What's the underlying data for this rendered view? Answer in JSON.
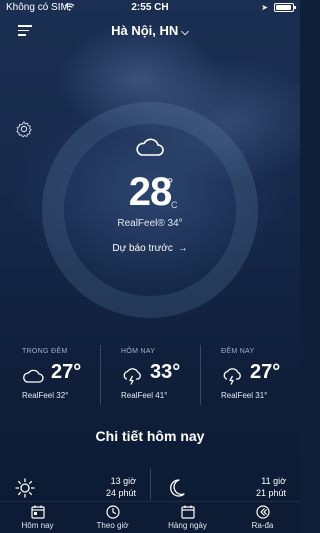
{
  "status_bar": {
    "carrier": "Không có SIM",
    "time": "2:55 CH",
    "battery_level": 0.95,
    "icons": [
      "wifi-icon",
      "location-arrow-icon",
      "battery-icon"
    ]
  },
  "header": {
    "city": "Hà Nội, HN",
    "menu_icon": "menu-icon",
    "dropdown_icon": "chevron-down-icon"
  },
  "settings_icon": "gear-icon",
  "current": {
    "icon": "cloud-icon",
    "temperature": "28",
    "degree": "°",
    "unit": "C",
    "realfeel": "RealFeel® 34°",
    "forecast_link": "Dự báo trước",
    "forecast_arrow": "→"
  },
  "periods": [
    {
      "label": "TRONG ĐÊM",
      "icon": "cloud-icon",
      "temp": "27°",
      "realfeel": "RealFeel 32°"
    },
    {
      "label": "HÔM NAY",
      "icon": "thunderstorm-icon",
      "temp": "33°",
      "realfeel": "RealFeel 41°"
    },
    {
      "label": "ĐÊM NAY",
      "icon": "thunderstorm-icon",
      "temp": "27°",
      "realfeel": "RealFeel 31°"
    }
  ],
  "details": {
    "title": "Chi tiết hôm nay",
    "sun_hours_line1": "13 giờ",
    "sun_hours_line2": "24 phút",
    "moon_hours_line1": "11 giờ",
    "moon_hours_line2": "21 phút"
  },
  "tabs": [
    {
      "label": "Hôm nay",
      "icon": "calendar-today-icon"
    },
    {
      "label": "Theo giờ",
      "icon": "clock-icon"
    },
    {
      "label": "Hàng ngày",
      "icon": "calendar-icon"
    },
    {
      "label": "Ra-đa",
      "icon": "radar-icon"
    }
  ],
  "colors": {
    "background": "#0f1f3a",
    "text": "#ffffff",
    "muted_label": "#9fb0c8"
  }
}
